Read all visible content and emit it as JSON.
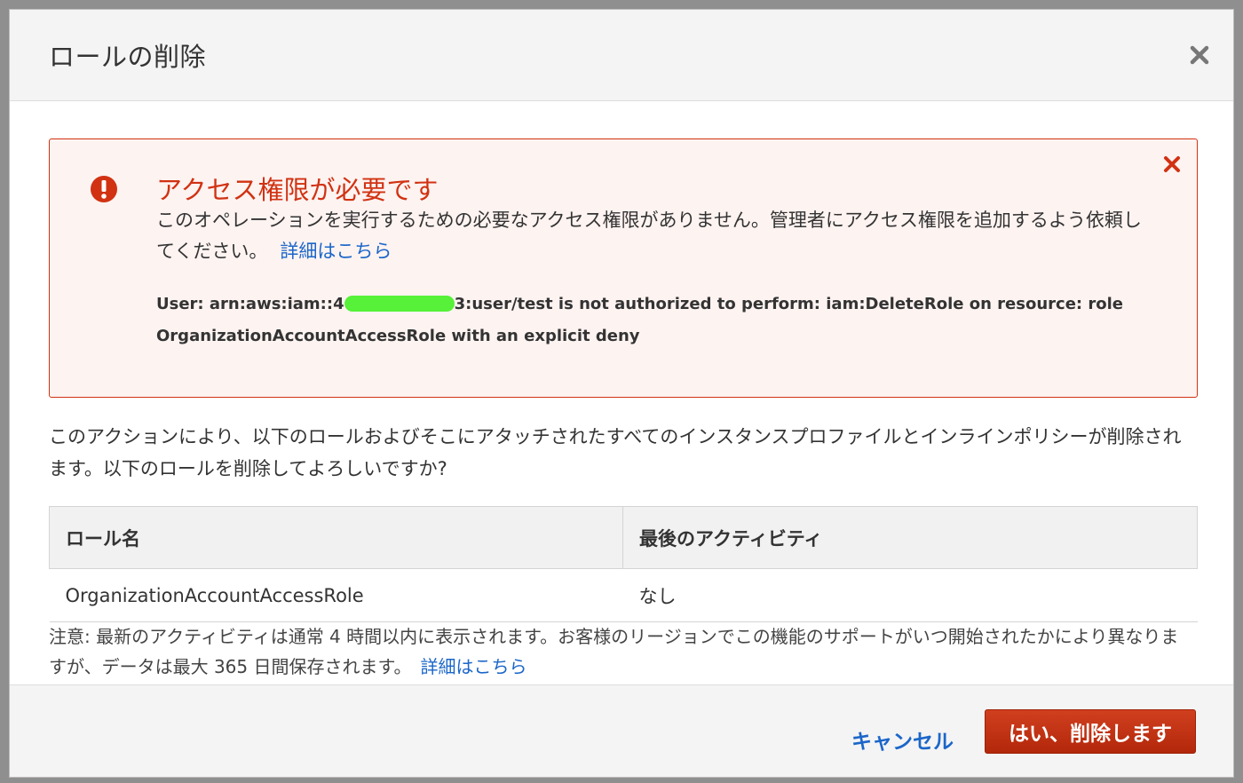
{
  "dialog": {
    "title": "ロールの削除",
    "close_icon": "close-icon"
  },
  "alert": {
    "icon": "exclamation-circle-icon",
    "title": "アクセス権限が必要です",
    "message": "このオペレーションを実行するための必要なアクセス権限がありません。管理者にアクセス権限を追加するよう依頼してください。",
    "link_label": "詳細はこちら",
    "error_prefix": "User: arn:aws:iam::4",
    "error_suffix": "3:user/test is not authorized to perform: iam:DeleteRole on resource: role OrganizationAccountAccessRole with an explicit deny",
    "dismiss_icon": "close-icon"
  },
  "body": {
    "text": "このアクションにより、以下のロールおよびそこにアタッチされたすべてのインスタンスプロファイルとインラインポリシーが削除されます。以下のロールを削除してよろしいですか?"
  },
  "table": {
    "headers": [
      "ロール名",
      "最後のアクティビティ"
    ],
    "rows": [
      [
        "OrganizationAccountAccessRole",
        "なし"
      ]
    ]
  },
  "note": {
    "text": "注意: 最新のアクティビティは通常 4 時間以内に表示されます。お客様のリージョンでこの機能のサポートがいつ開始されたかにより異なりますが、データは最大 365 日間保存されます。",
    "link_label": "詳細はこちら"
  },
  "footer": {
    "cancel_label": "キャンセル",
    "delete_label": "はい、削除します"
  },
  "colors": {
    "error": "#d13212",
    "link": "#1b66c9",
    "primary_button": "#c1300f"
  }
}
